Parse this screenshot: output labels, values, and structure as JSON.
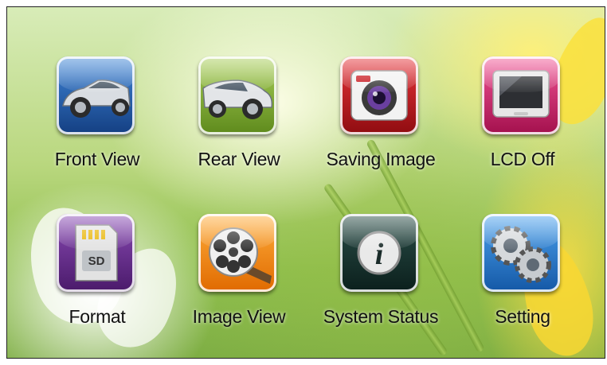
{
  "menu": {
    "items": [
      {
        "label": "Front View",
        "icon": "front-car-icon",
        "color": "#1f5fb0"
      },
      {
        "label": "Rear View",
        "icon": "rear-car-icon",
        "color": "#7aa62a"
      },
      {
        "label": "Saving Image",
        "icon": "camera-icon",
        "color": "#c8161d"
      },
      {
        "label": "LCD Off",
        "icon": "monitor-icon",
        "color": "#d2216f"
      },
      {
        "label": "Format",
        "icon": "sd-card-icon",
        "color": "#6b2a8f"
      },
      {
        "label": "Image View",
        "icon": "film-reel-icon",
        "color": "#f07a10"
      },
      {
        "label": "System Status",
        "icon": "info-icon",
        "color": "#12302c"
      },
      {
        "label": "Setting",
        "icon": "gears-icon",
        "color": "#1f7ad0"
      }
    ]
  }
}
